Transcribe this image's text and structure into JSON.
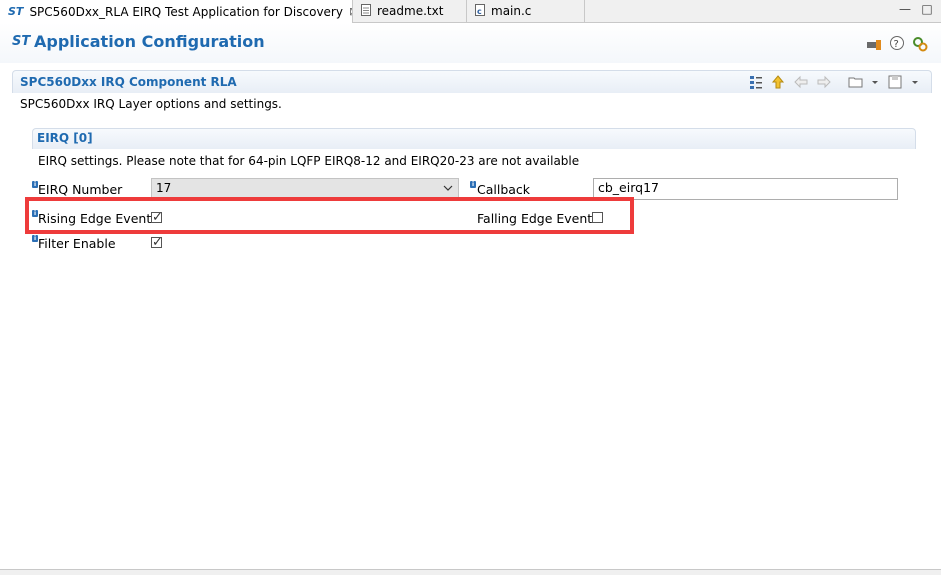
{
  "tabs": [
    {
      "label": "SPC560Dxx_RLA EIRQ Test Application for Discovery",
      "icon": "st-logo-icon",
      "close": "⊠",
      "active": true
    },
    {
      "label": "readme.txt",
      "icon": "text-file-icon",
      "active": false
    },
    {
      "label": "main.c",
      "icon": "c-file-icon",
      "active": false
    }
  ],
  "window_controls": {
    "minimize": "—",
    "maximize": "□"
  },
  "header": {
    "title": "Application Configuration",
    "icons": [
      "hammer-icon",
      "help-icon",
      "settings-icon"
    ]
  },
  "component": {
    "title": "SPC560Dxx IRQ Component RLA",
    "description": "SPC560Dxx IRQ Layer options and settings.",
    "toolbar_icons": [
      "tree-icon",
      "up-arrow-icon",
      "back-arrow-icon",
      "forward-arrow-icon",
      "open-folder-icon",
      "save-icon"
    ]
  },
  "eirq": {
    "title": "EIRQ [0]",
    "description": "EIRQ settings. Please note that for 64-pin LQFP EIRQ8-12 and EIRQ20-23 are not available",
    "fields": {
      "eirq_number_label": "EIRQ Number",
      "eirq_number_value": "17",
      "callback_label": "Callback",
      "callback_value": "cb_eirq17",
      "rising_label": "Rising Edge Event",
      "rising_checked": true,
      "falling_label": "Falling Edge Event",
      "falling_checked": false,
      "filter_label": "Filter Enable",
      "filter_checked": true
    }
  },
  "colors": {
    "accent": "#1f6ab0",
    "highlight": "#ee3b3b"
  }
}
